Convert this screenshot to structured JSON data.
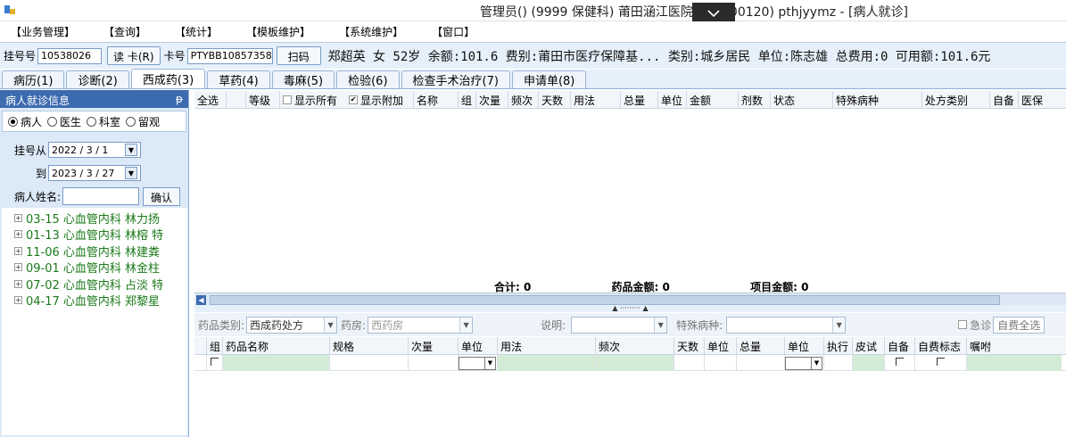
{
  "window": {
    "title": "管理员() (9999 保健科) 莆田涵江医院(350300120) pthjyymz - [病人就诊]"
  },
  "menu": [
    "【业务管理】",
    "【查询】",
    "【统计】",
    "【模板维护】",
    "【系统维护】",
    "【窗口】"
  ],
  "patient_bar": {
    "reg_label": "挂号号",
    "reg_value": "10538026",
    "read_card_label": "读 卡(R)",
    "card_label": "卡号",
    "card_value": "PTYBB10857358",
    "scan_label": "扫码",
    "summary": "郑超英 女 52岁 余额:101.6 费别:莆田市医疗保障基... 类别:城乡居民 单位:陈志雄 总费用:0 可用额:101.6元"
  },
  "tabs": [
    {
      "label": "病历(1)",
      "active": false
    },
    {
      "label": "诊断(2)",
      "active": false
    },
    {
      "label": "西成药(3)",
      "active": true
    },
    {
      "label": "草药(4)",
      "active": false
    },
    {
      "label": "毒麻(5)",
      "active": false
    },
    {
      "label": "检验(6)",
      "active": false
    },
    {
      "label": "检查手术治疗(7)",
      "active": false
    },
    {
      "label": "申请单(8)",
      "active": false
    }
  ],
  "left_panel": {
    "title": "病人就诊信息",
    "pin": "ᵽ",
    "radios": [
      {
        "label": "病人",
        "checked": true
      },
      {
        "label": "医生",
        "checked": false
      },
      {
        "label": "科室",
        "checked": false
      },
      {
        "label": "留观",
        "checked": false
      }
    ],
    "date_from_label": "挂号从",
    "date_from": "2022 / 3 / 1",
    "date_to_label": "到",
    "date_to": "2023 / 3 / 27",
    "name_label": "病人姓名:",
    "confirm_label": "确认",
    "visits": [
      "03-15 心血管内科 林力扬",
      "01-13 心血管内科 林榕 特",
      "11-06 心血管内科 林建粪",
      "09-01 心血管内科 林金柱",
      "07-02 心血管内科 占淡 特",
      "04-17 心血管内科 郑黎星"
    ]
  },
  "upper_grid": {
    "columns": [
      "全选",
      "",
      "等级",
      "显示所有",
      "显示附加",
      "名称",
      "组",
      "次量",
      "频次",
      "天数",
      "用法",
      "总量",
      "单位",
      "金额",
      "剂数",
      "状态",
      "特殊病种",
      "处方类别",
      "自备",
      "医保"
    ],
    "show_all_checked": false,
    "show_extra_checked": true,
    "totals": {
      "total_label": "合计:",
      "total_value": "0",
      "drug_label": "药品金额:",
      "drug_value": "0",
      "item_label": "项目金额:",
      "item_value": "0"
    }
  },
  "filter_bar": {
    "drug_type_label": "药品类别:",
    "drug_type_value": "西成药处方",
    "pharmacy_label": "药房:",
    "pharmacy_value": "西药房",
    "note_label": "说明:",
    "special_label": "特殊病种:",
    "emergency_label": "急诊",
    "self_pay_all_label": "自费全选"
  },
  "lower_grid": {
    "columns": [
      "组",
      "药品名称",
      "规格",
      "次量",
      "单位",
      "用法",
      "频次",
      "天数",
      "单位",
      "总量",
      "单位",
      "执行",
      "皮试",
      "自备",
      "自费标志",
      "嘱咐"
    ]
  }
}
